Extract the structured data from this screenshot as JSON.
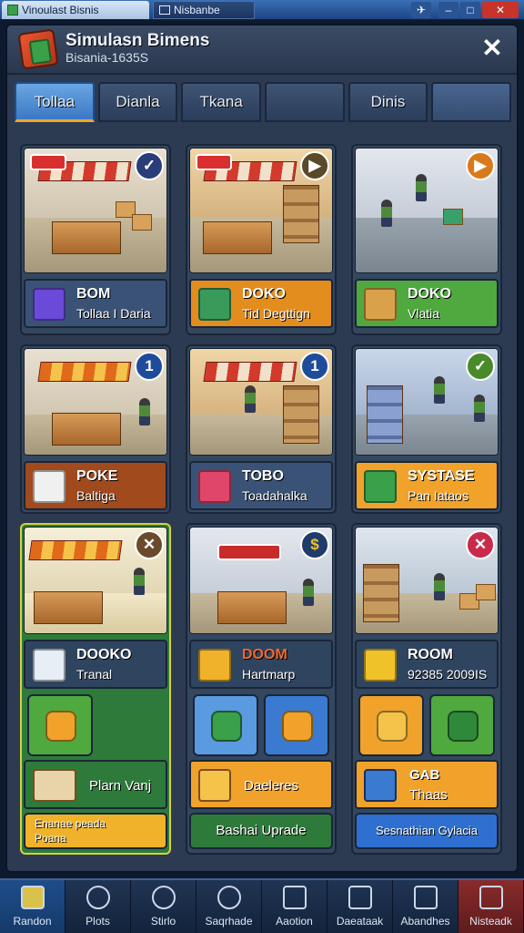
{
  "os_bar": {
    "tab1": "Vinoulast Bisnis",
    "tab2": "Nisbanbe"
  },
  "header": {
    "title": "Simulasn Bimens",
    "subtitle": "Bisania-1635S"
  },
  "tabs": [
    "Tollaa",
    "Dianla",
    "Tkana",
    "",
    "Dinis",
    ""
  ],
  "cards": [
    {
      "t1": "BOM",
      "t2": "Tollaa I Daria",
      "badge": "✓",
      "badge_color": "#2a3d7a"
    },
    {
      "t1": "DOKO",
      "t2": "Tid Degttign",
      "badge": "▶",
      "badge_color": "#5a4a2a"
    },
    {
      "t1": "DOKO",
      "t2": "Vlatia",
      "badge": "▶",
      "badge_color": "#d97a1a"
    },
    {
      "t1": "POKE",
      "t2": "Baltiga",
      "badge": "1",
      "badge_color": "#1f4c9a"
    },
    {
      "t1": "TOBO",
      "t2": "Toadahalka",
      "badge": "1",
      "badge_color": "#1f4c9a"
    },
    {
      "t1": "SYSTASE",
      "t2": "Pan Iataos",
      "badge": "✓",
      "badge_color": "#4a8a2a"
    },
    {
      "t1": "DOOKO",
      "t2": "Tranal",
      "badge": "✕",
      "badge_color": "#6a4a2a"
    },
    {
      "t1": "DOOM",
      "t2": "Hartmarp",
      "badge": "$",
      "badge_color": "#1f3c6a"
    },
    {
      "t1": "ROOM",
      "t2": "92385 2009IS",
      "badge": "✕",
      "badge_color": "#c92a4a"
    }
  ],
  "lower": {
    "col1_wide": "Plarn Vanj",
    "col1_btn_line1": "Enanae peada",
    "col1_btn_line2": "Poana",
    "col2_wide": "Daeleres",
    "col2_btn": "Bashai Uprade",
    "col3_wide_line1": "GAB",
    "col3_wide_line2": "Thaas",
    "col3_btn": "Sesnathian Gylacia"
  },
  "nav": [
    "Randon",
    "Plots",
    "Stirlo",
    "Saqrhade",
    "Aaotion",
    "Daeataak",
    "Abandhes",
    "Nisteadk"
  ],
  "colors": {
    "orange": "#f0a22a",
    "green": "#4fa93e",
    "blue": "#2f6fd0",
    "navy": "#2c3d57"
  }
}
